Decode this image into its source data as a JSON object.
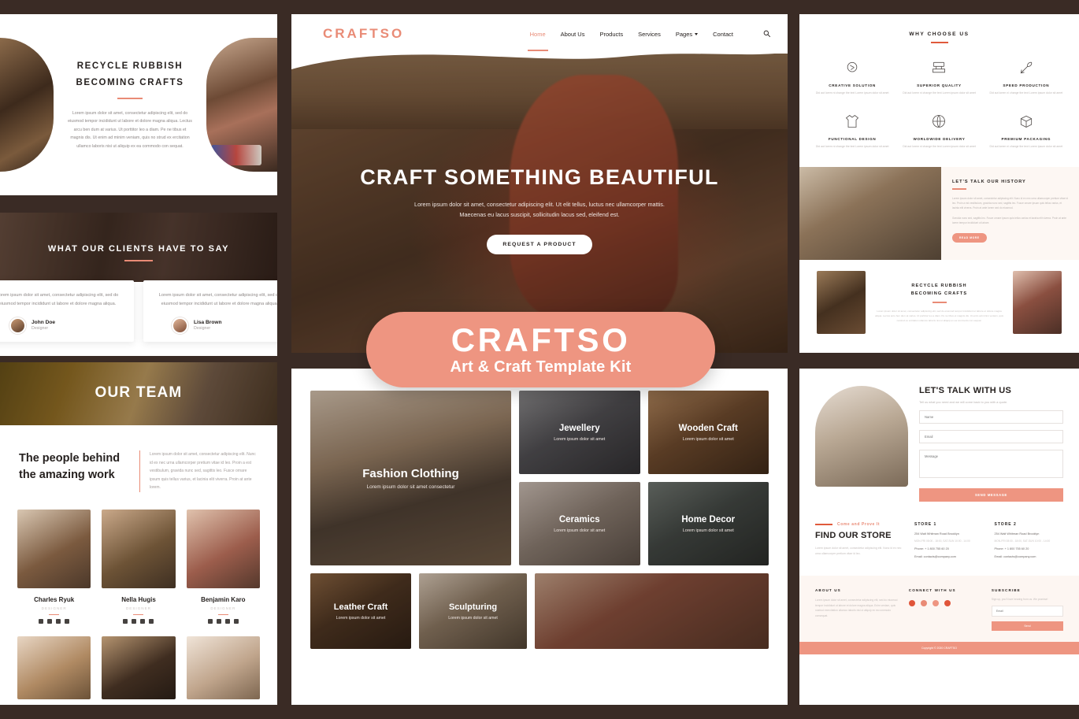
{
  "site": {
    "brand": "CRAFTSO",
    "nav": [
      {
        "label": "Home",
        "active": true
      },
      {
        "label": "About Us",
        "active": false
      },
      {
        "label": "Products",
        "active": false
      },
      {
        "label": "Services",
        "active": false
      },
      {
        "label": "Pages",
        "active": false,
        "dropdown": true
      },
      {
        "label": "Contact",
        "active": false
      }
    ],
    "search_icon": "search-icon"
  },
  "hero": {
    "heading": "CRAFT SOMETHING BEAUTIFUL",
    "paragraph_line1": "Lorem ipsum dolor sit amet, consectetur adipiscing elit. Ut elit tellus, luctus nec ullamcorper mattis.",
    "paragraph_line2": "Maecenas eu lacus suscipit, sollicitudin lacus sed, eleifend est.",
    "cta": "REQUEST A PRODUCT"
  },
  "badge": {
    "title": "CRAFTSO",
    "subtitle": "Art & Craft Template Kit",
    "color": "#ee9581"
  },
  "recycle": {
    "title_line1": "RECYCLE RUBBISH",
    "title_line2": "BECOMING CRAFTS",
    "body": "Lorem ipsum dolor sit amet, consectetur adipiscing elit, sed do eiusmod tempor incididunt ut labore et dolore magna aliqua. Lectus arcu ben dum at varius. Ut porttitor leo a diam. Pe ne tibus et magnis dis. Ut enim ad minim veniam, quis no strud ex ercitation ullamco laboris nisi ut aliquip ex ea commodo con sequat."
  },
  "testimonials": {
    "title": "WHAT OUR CLIENTS HAVE TO SAY",
    "items": [
      {
        "text": "Lorem ipsum dolor sit amet, consectetur adipiscing elit, sed do eiusmod tempor incididunt ut labore et dolore magna aliqua.",
        "name": "John Doe",
        "role": "Designer"
      },
      {
        "text": "Lorem ipsum dolor sit amet, consectetur adipiscing elit, sed do eiusmod tempor incididunt ut labore et dolore magna aliqua.",
        "name": "Lisa Brown",
        "role": "Designer"
      }
    ]
  },
  "team": {
    "hero_title": "OUR TEAM",
    "heading_line1": "The people behind",
    "heading_line2": "the amazing work",
    "paragraph": "Lorem ipsum dolor sit amet, consectetur adipiscing elit. Nunc id ex nec urna ullamcorper pretium vitae id leo. Proin a est vestibulum, gravida nunc sed, sagittis leo. Fusce ornare ipsum quis tellus varius, et lacinia elit viverra. Proin at ante lorem.",
    "members": [
      {
        "name": "Charles Ryuk",
        "role": "DESIGNER"
      },
      {
        "name": "Nella Hugis",
        "role": "DESIGNER"
      },
      {
        "name": "Benjamin Karo",
        "role": "DESIGNER"
      }
    ]
  },
  "products": [
    {
      "name": "Fashion Clothing",
      "sub": "Lorem ipsum dolor sit amet consectetur"
    },
    {
      "name": "Jewellery",
      "sub": "Lorem ipsum dolor sit amet"
    },
    {
      "name": "Wooden Craft",
      "sub": "Lorem ipsum dolor sit amet"
    },
    {
      "name": "Ceramics",
      "sub": "Lorem ipsum dolor sit amet"
    },
    {
      "name": "Home Decor",
      "sub": "Lorem ipsum dolor sit amet"
    },
    {
      "name": "Leather Craft",
      "sub": "Lorem ipsum dolor sit amet"
    },
    {
      "name": "Sculpturing",
      "sub": "Lorem ipsum dolor sit amet"
    }
  ],
  "why": {
    "title": "WHY CHOOSE US",
    "features": [
      {
        "name": "CREATIVE SOLUTION",
        "icon": "brain-icon",
        "desc": "Did aut lorem ni change the text Lorem ipsum dolor sit amet"
      },
      {
        "name": "SUPERIOR QUALITY",
        "icon": "stamp-icon",
        "desc": "Did aut lorem ni change the text Lorem ipsum dolor sit amet"
      },
      {
        "name": "SPEED PRODUCTION",
        "icon": "rocket-icon",
        "desc": "Did aut lorem ni change the text Lorem ipsum dolor sit amet"
      },
      {
        "name": "FUNCTIONAL DESIGN",
        "icon": "shirt-icon",
        "desc": "Did aut lorem ni change the text Lorem ipsum dolor sit amet"
      },
      {
        "name": "WORLDWIDE DELIVERY",
        "icon": "globe-icon",
        "desc": "Did aut lorem ni change the text Lorem ipsum dolor sit amet"
      },
      {
        "name": "PREMIUM PACKAGING",
        "icon": "box-icon",
        "desc": "Did aut lorem ni change the text Lorem ipsum dolor sit amet"
      }
    ]
  },
  "history": {
    "title": "LET'S TALK OUR HISTORY",
    "paragraph1": "Lorem ipsum dolor sit amet, consectetur adipiscing elit. Nunc id ex nec urna ullamcorper pretium vitae id leo. Proin a est vestibulum, gravida nunc sed, sagittis leo. Fusce ornare ipsum quis tellus varius, et lacinia elit viverra. Proin at ante lorem sed do eiusmod.",
    "paragraph2": "Gravida nunc sed, sagittis leo. Fusce ornare ipsum quis tellus varius et lacinia elit viverra. Proin at ante lorem tempor incididunt ut labore.",
    "button": "READ MORE"
  },
  "recycle2": {
    "title_line1": "RECYCLE RUBBISH",
    "title_line2": "BECOMING CRAFTS",
    "body": "Lorem ipsum dolor sit amet, consectetur adipiscing elit, sed do eiusmod tempor incididunt ut labore et dolore magna aliqua. Lectus arcu ben dum at varius. Ut porttitor leo a diam. Pe ne tibus et magnis dis. Ut enim ad minim veniam, quis nostrud ex ercitation ullamco laboris nisi ut aliquip ex ea commodo con sequat."
  },
  "contact": {
    "heading": "LET'S TALK WITH US",
    "subtitle": "Tell us what you need and we will come back to you with a quote.",
    "name_placeholder": "Name",
    "email_placeholder": "Email",
    "message_placeholder": "Message",
    "send_label": "SEND MESSAGE"
  },
  "find_store": {
    "kicker": "Come and Prove It",
    "heading": "FIND OUR STORE",
    "paragraph": "Lorem ipsum dolor sit amet, consectetur adipiscing elit. Nunc id ex nec urna ullamcorper pretium vitae id leo.",
    "stores": [
      {
        "title": "STORE 1",
        "address": "254 Walt Whitman Road Brooklyn",
        "hours": "MON-FRI 08:00 - 18:00, SAT-SUN 10:00 - 14:00",
        "phone": "Phone: + 1 800 755 60 20",
        "email": "Email: contacts@company.com"
      },
      {
        "title": "STORE 2",
        "address": "254 Walt Whitman Road Brooklyn",
        "hours": "MON-FRI 08:00 - 18:00, SAT-SUN 10:00 - 14:00",
        "phone": "Phone: + 1 800 755 60 20",
        "email": "Email: contacts@company.com"
      }
    ]
  },
  "footer": {
    "about_title": "ABOUT US",
    "about_text": "Lorem ipsum dolor sit amet, consectetur adipiscing elit, sed do eiusmod tempor incididunt ut labore et dolore magna aliqua. Enim veniam, quis nostrud exercitation ullamco laboris nisi ut aliquip ex ea commodo consequat.",
    "connect_title": "CONNECT WITH US",
    "social": [
      "facebook-icon",
      "twitter-icon",
      "instagram-icon",
      "pinterest-icon"
    ],
    "subscribe_title": "SUBSCRIBE",
    "subscribe_text": "Sign up, you'll love hearing from us. We promise!",
    "subscribe_placeholder": "Email",
    "subscribe_button": "Send",
    "copyright": "Copyright © 2020 CRAFTSO"
  }
}
